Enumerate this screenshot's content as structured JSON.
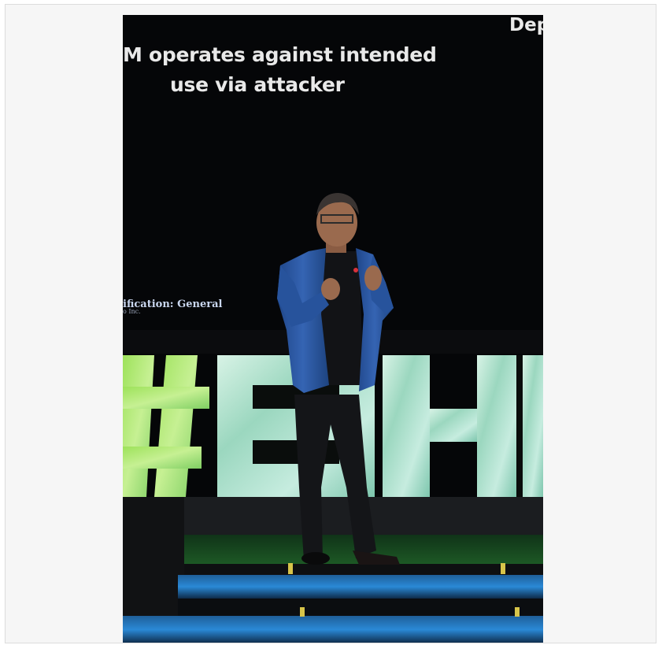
{
  "slide": {
    "headline_line1": "M operates against intended",
    "headline_line2": "use via attacker",
    "corner_text": "Dep",
    "classification": "ification: General",
    "fine_print": "o Inc."
  },
  "signage": {
    "letters": "#BH"
  },
  "colors": {
    "background": "#050608",
    "sign_glow": "#9fd8c2",
    "blazer": "#2d5aa6",
    "stage_blue": "#2a89d6"
  }
}
